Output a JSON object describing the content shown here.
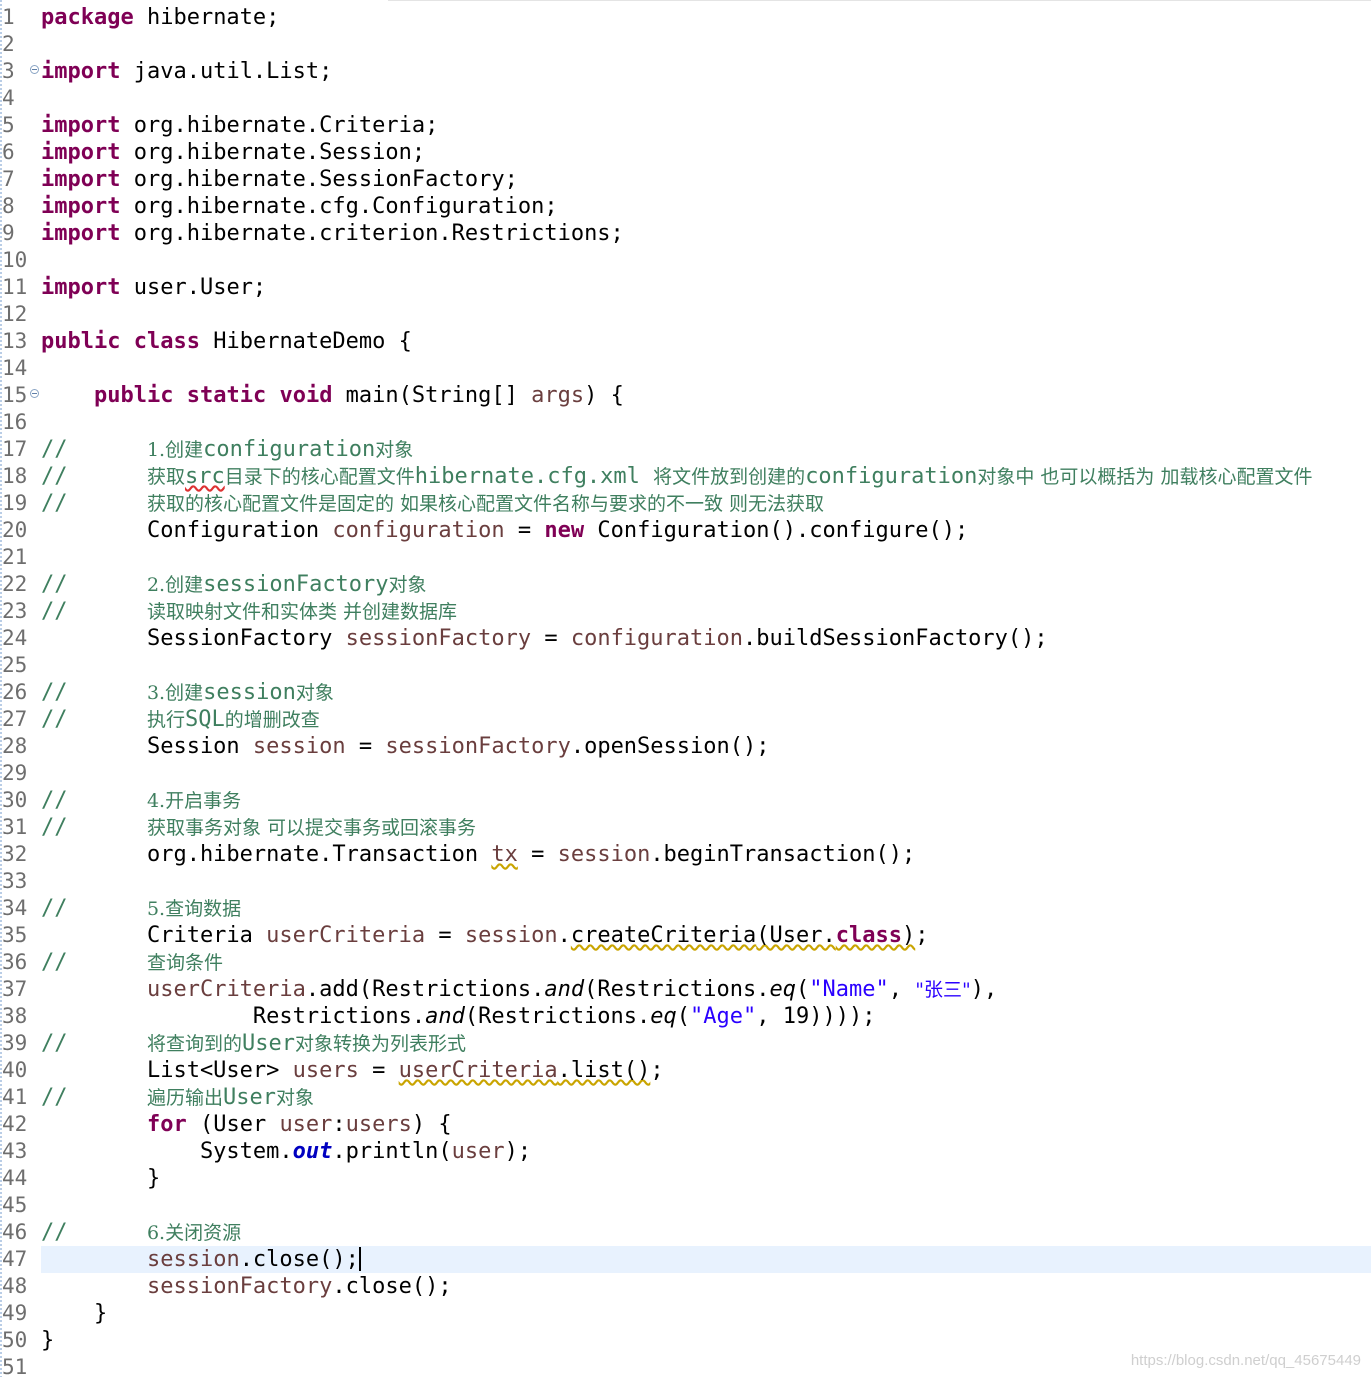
{
  "editor": {
    "current_line": 47,
    "watermark": "https://blog.csdn.net/qq_45675449",
    "lines": [
      {
        "n": "1",
        "segs": [
          {
            "t": "package",
            "c": "kw"
          },
          {
            "t": " hibernate;"
          }
        ]
      },
      {
        "n": "2",
        "segs": []
      },
      {
        "n": "3",
        "fold": true,
        "segs": [
          {
            "t": "import",
            "c": "kw"
          },
          {
            "t": " java.util.List;"
          }
        ]
      },
      {
        "n": "4",
        "segs": []
      },
      {
        "n": "5",
        "segs": [
          {
            "t": "import",
            "c": "kw"
          },
          {
            "t": " org.hibernate.Criteria;"
          }
        ]
      },
      {
        "n": "6",
        "segs": [
          {
            "t": "import",
            "c": "kw"
          },
          {
            "t": " org.hibernate.Session;"
          }
        ]
      },
      {
        "n": "7",
        "segs": [
          {
            "t": "import",
            "c": "kw"
          },
          {
            "t": " org.hibernate.SessionFactory;"
          }
        ]
      },
      {
        "n": "8",
        "segs": [
          {
            "t": "import",
            "c": "kw"
          },
          {
            "t": " org.hibernate.cfg.Configuration;"
          }
        ]
      },
      {
        "n": "9",
        "segs": [
          {
            "t": "import",
            "c": "kw"
          },
          {
            "t": " org.hibernate.criterion.Restrictions;"
          }
        ]
      },
      {
        "n": "10",
        "segs": []
      },
      {
        "n": "11",
        "segs": [
          {
            "t": "import",
            "c": "kw"
          },
          {
            "t": " user.User;"
          }
        ]
      },
      {
        "n": "12",
        "segs": []
      },
      {
        "n": "13",
        "segs": [
          {
            "t": "public",
            "c": "kw"
          },
          {
            "t": " "
          },
          {
            "t": "class",
            "c": "kw"
          },
          {
            "t": " HibernateDemo {"
          }
        ]
      },
      {
        "n": "14",
        "segs": []
      },
      {
        "n": "15",
        "fold": true,
        "segs": [
          {
            "t": "    "
          },
          {
            "t": "public",
            "c": "kw"
          },
          {
            "t": " "
          },
          {
            "t": "static",
            "c": "kw"
          },
          {
            "t": " "
          },
          {
            "t": "void",
            "c": "kw"
          },
          {
            "t": " main(String[] "
          },
          {
            "t": "args",
            "c": "fld"
          },
          {
            "t": ") {"
          }
        ]
      },
      {
        "n": "16",
        "segs": []
      },
      {
        "n": "17",
        "segs": [
          {
            "t": "//      ",
            "c": "cm"
          },
          {
            "t": "1.创建",
            "c": "cmt"
          },
          {
            "t": "configuration",
            "c": "cm"
          },
          {
            "t": "对象",
            "c": "cmt"
          }
        ]
      },
      {
        "n": "18",
        "segs": [
          {
            "t": "//      ",
            "c": "cm"
          },
          {
            "t": "获取",
            "c": "cmt"
          },
          {
            "t": "src",
            "c": "cm sqr"
          },
          {
            "t": "目录下的核心配置文件",
            "c": "cmt"
          },
          {
            "t": "hibernate.cfg.xml ",
            "c": "cm"
          },
          {
            "t": "将文件放到创建的",
            "c": "cmt"
          },
          {
            "t": "configuration",
            "c": "cm"
          },
          {
            "t": "对象中 也可以概括为 加载核心配置文件",
            "c": "cmt"
          }
        ]
      },
      {
        "n": "19",
        "segs": [
          {
            "t": "//      ",
            "c": "cm"
          },
          {
            "t": "获取的核心配置文件是固定的 如果核心配置文件名称与要求的不一致 则无法获取",
            "c": "cmt"
          }
        ]
      },
      {
        "n": "20",
        "segs": [
          {
            "t": "        Configuration "
          },
          {
            "t": "configuration",
            "c": "fld"
          },
          {
            "t": " = "
          },
          {
            "t": "new",
            "c": "kw"
          },
          {
            "t": " Configuration().configure();"
          }
        ]
      },
      {
        "n": "21",
        "segs": []
      },
      {
        "n": "22",
        "segs": [
          {
            "t": "//      ",
            "c": "cm"
          },
          {
            "t": "2.创建",
            "c": "cmt"
          },
          {
            "t": "sessionFactory",
            "c": "cm"
          },
          {
            "t": "对象",
            "c": "cmt"
          }
        ]
      },
      {
        "n": "23",
        "segs": [
          {
            "t": "//      ",
            "c": "cm"
          },
          {
            "t": "读取映射文件和实体类 并创建数据库",
            "c": "cmt"
          }
        ]
      },
      {
        "n": "24",
        "segs": [
          {
            "t": "        SessionFactory "
          },
          {
            "t": "sessionFactory",
            "c": "fld"
          },
          {
            "t": " = "
          },
          {
            "t": "configuration",
            "c": "fld"
          },
          {
            "t": ".buildSessionFactory();"
          }
        ]
      },
      {
        "n": "25",
        "segs": []
      },
      {
        "n": "26",
        "segs": [
          {
            "t": "//      ",
            "c": "cm"
          },
          {
            "t": "3.创建",
            "c": "cmt"
          },
          {
            "t": "session",
            "c": "cm"
          },
          {
            "t": "对象",
            "c": "cmt"
          }
        ]
      },
      {
        "n": "27",
        "segs": [
          {
            "t": "//      ",
            "c": "cm"
          },
          {
            "t": "执行",
            "c": "cmt"
          },
          {
            "t": "SQL",
            "c": "cm"
          },
          {
            "t": "的增删改查",
            "c": "cmt"
          }
        ]
      },
      {
        "n": "28",
        "segs": [
          {
            "t": "        Session "
          },
          {
            "t": "session",
            "c": "fld"
          },
          {
            "t": " = "
          },
          {
            "t": "sessionFactory",
            "c": "fld"
          },
          {
            "t": ".openSession();"
          }
        ]
      },
      {
        "n": "29",
        "segs": []
      },
      {
        "n": "30",
        "segs": [
          {
            "t": "//      ",
            "c": "cm"
          },
          {
            "t": "4.开启事务",
            "c": "cmt"
          }
        ]
      },
      {
        "n": "31",
        "segs": [
          {
            "t": "//      ",
            "c": "cm"
          },
          {
            "t": "获取事务对象 可以提交事务或回滚事务",
            "c": "cmt"
          }
        ]
      },
      {
        "n": "32",
        "segs": [
          {
            "t": "        org.hibernate.Transaction "
          },
          {
            "t": "tx",
            "c": "fld sq"
          },
          {
            "t": " = "
          },
          {
            "t": "session",
            "c": "fld"
          },
          {
            "t": ".beginTransaction();"
          }
        ]
      },
      {
        "n": "33",
        "segs": []
      },
      {
        "n": "34",
        "segs": [
          {
            "t": "//      ",
            "c": "cm"
          },
          {
            "t": "5.查询数据",
            "c": "cmt"
          }
        ]
      },
      {
        "n": "35",
        "segs": [
          {
            "t": "        Criteria "
          },
          {
            "t": "userCriteria",
            "c": "fld"
          },
          {
            "t": " = "
          },
          {
            "t": "session",
            "c": "fld"
          },
          {
            "t": "."
          },
          {
            "t": "createCriteria",
            "c": "dep sq"
          },
          {
            "t": "(User.",
            "c": "sq"
          },
          {
            "t": "class",
            "c": "kw sq"
          },
          {
            "t": ")",
            "c": "sq"
          },
          {
            "t": ";"
          }
        ]
      },
      {
        "n": "36",
        "segs": [
          {
            "t": "//      ",
            "c": "cm"
          },
          {
            "t": "查询条件",
            "c": "cmt"
          }
        ]
      },
      {
        "n": "37",
        "segs": [
          {
            "t": "        "
          },
          {
            "t": "userCriteria",
            "c": "fld"
          },
          {
            "t": ".add(Restrictions."
          },
          {
            "t": "and",
            "c": "st"
          },
          {
            "t": "(Restrictions."
          },
          {
            "t": "eq",
            "c": "st"
          },
          {
            "t": "("
          },
          {
            "t": "\"Name\"",
            "c": "str"
          },
          {
            "t": ", "
          },
          {
            "t": "\"张三\"",
            "c": "strz"
          },
          {
            "t": "),"
          }
        ]
      },
      {
        "n": "38",
        "segs": [
          {
            "t": "                Restrictions."
          },
          {
            "t": "and",
            "c": "st"
          },
          {
            "t": "(Restrictions."
          },
          {
            "t": "eq",
            "c": "st"
          },
          {
            "t": "("
          },
          {
            "t": "\"Age\"",
            "c": "str"
          },
          {
            "t": ", 19))));"
          }
        ]
      },
      {
        "n": "39",
        "segs": [
          {
            "t": "//      ",
            "c": "cm"
          },
          {
            "t": "将查询到的",
            "c": "cmt"
          },
          {
            "t": "User",
            "c": "cm"
          },
          {
            "t": "对象转换为列表形式",
            "c": "cmt"
          }
        ]
      },
      {
        "n": "40",
        "segs": [
          {
            "t": "        List<User> "
          },
          {
            "t": "users",
            "c": "fld"
          },
          {
            "t": " = "
          },
          {
            "t": "userCriteria",
            "c": "fld sq"
          },
          {
            "t": ".list()",
            "c": "sq"
          },
          {
            "t": ";"
          }
        ]
      },
      {
        "n": "41",
        "segs": [
          {
            "t": "//      ",
            "c": "cm"
          },
          {
            "t": "遍历输出",
            "c": "cmt"
          },
          {
            "t": "User",
            "c": "cm"
          },
          {
            "t": "对象",
            "c": "cmt"
          }
        ]
      },
      {
        "n": "42",
        "segs": [
          {
            "t": "        "
          },
          {
            "t": "for",
            "c": "kw"
          },
          {
            "t": " (User "
          },
          {
            "t": "user",
            "c": "fld"
          },
          {
            "t": ":"
          },
          {
            "t": "users",
            "c": "fld"
          },
          {
            "t": ") {"
          }
        ]
      },
      {
        "n": "43",
        "segs": [
          {
            "t": "            System."
          },
          {
            "t": "out",
            "c": "so"
          },
          {
            "t": ".println("
          },
          {
            "t": "user",
            "c": "fld"
          },
          {
            "t": ");"
          }
        ]
      },
      {
        "n": "44",
        "segs": [
          {
            "t": "        }"
          }
        ]
      },
      {
        "n": "45",
        "segs": []
      },
      {
        "n": "46",
        "segs": [
          {
            "t": "//      ",
            "c": "cm"
          },
          {
            "t": "6.关闭资源",
            "c": "cmt"
          }
        ]
      },
      {
        "n": "47",
        "segs": [
          {
            "t": "        "
          },
          {
            "t": "session",
            "c": "fld"
          },
          {
            "t": ".close();"
          }
        ]
      },
      {
        "n": "48",
        "segs": [
          {
            "t": "        "
          },
          {
            "t": "sessionFactory",
            "c": "fld"
          },
          {
            "t": ".close();"
          }
        ]
      },
      {
        "n": "49",
        "segs": [
          {
            "t": "    }"
          }
        ]
      },
      {
        "n": "50",
        "segs": [
          {
            "t": "}"
          }
        ]
      },
      {
        "n": "51",
        "segs": []
      }
    ]
  }
}
